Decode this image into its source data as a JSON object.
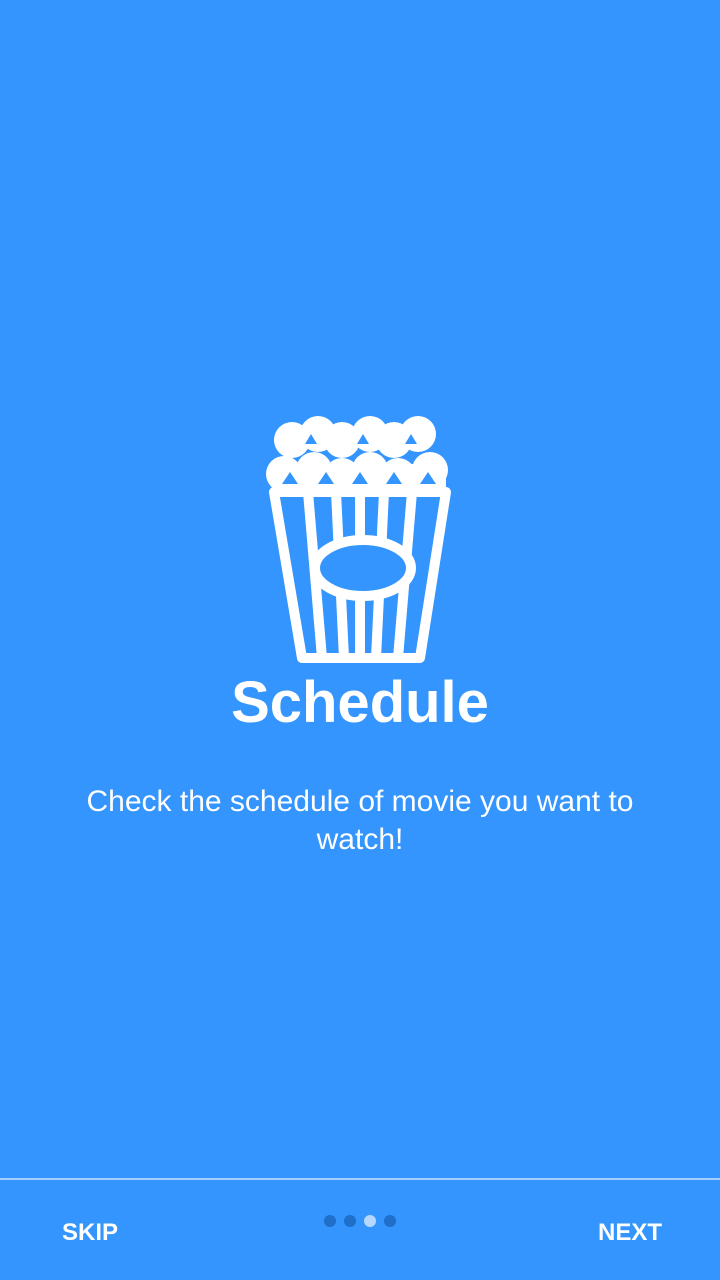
{
  "onboarding": {
    "icon": "popcorn-icon",
    "title": "Schedule",
    "description": "Check the schedule of movie you want to watch!",
    "background_color": "#3395fd",
    "page_indicator": {
      "total_pages": 4,
      "current_page": 3,
      "active_color": "#b6d8ff",
      "inactive_color": "#1f6fc9"
    }
  },
  "footer": {
    "skip_label": "SKIP",
    "next_label": "NEXT"
  }
}
